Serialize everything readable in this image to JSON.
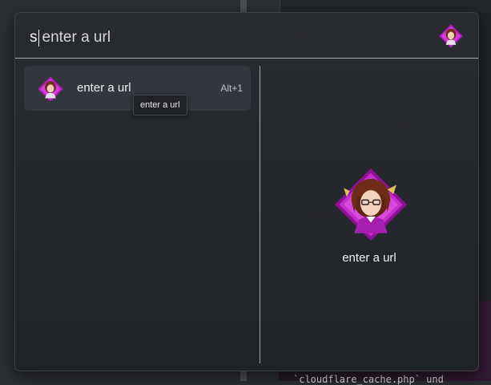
{
  "search": {
    "typed": "s",
    "placeholder_suggestion": "enter a url"
  },
  "results": [
    {
      "title": "enter a url",
      "shortcut": "Alt+1",
      "icon": "anime-avatar-icon",
      "tooltip": "enter a url"
    }
  ],
  "preview": {
    "title": "enter a url",
    "icon": "anime-avatar-icon"
  },
  "background": {
    "code_snippet": "`cloudflare_cache.php` und"
  },
  "colors": {
    "accent_magenta": "#c020c8",
    "panel_bg": "#24272b",
    "selection_bg": "#33363c",
    "divider": "#a8abb0"
  }
}
